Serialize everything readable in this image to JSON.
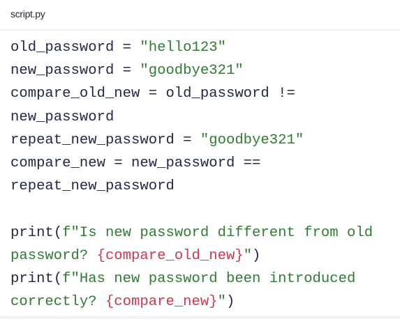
{
  "header": {
    "filename": "script.py"
  },
  "code": {
    "language": "python",
    "colors": {
      "plain": "#232848",
      "string": "#2e7d32",
      "interpolation": "#d1384f"
    },
    "lines": [
      [
        {
          "t": "plain",
          "v": "old_password = "
        },
        {
          "t": "string",
          "v": "\"hello123\""
        }
      ],
      [
        {
          "t": "plain",
          "v": "new_password = "
        },
        {
          "t": "string",
          "v": "\"goodbye321\""
        }
      ],
      [
        {
          "t": "plain",
          "v": "compare_old_new = old_password !="
        }
      ],
      [
        {
          "t": "plain",
          "v": "new_password"
        }
      ],
      [
        {
          "t": "plain",
          "v": "repeat_new_password = "
        },
        {
          "t": "string",
          "v": "\"goodbye321\""
        }
      ],
      [
        {
          "t": "plain",
          "v": "compare_new = new_password =="
        }
      ],
      [
        {
          "t": "plain",
          "v": "repeat_new_password"
        }
      ],
      [],
      [
        {
          "t": "plain",
          "v": "print("
        },
        {
          "t": "string",
          "v": "f\"Is new password different from old"
        }
      ],
      [
        {
          "t": "string",
          "v": "password? "
        },
        {
          "t": "interp",
          "v": "{compare_old_new}"
        },
        {
          "t": "string",
          "v": "\""
        },
        {
          "t": "plain",
          "v": ")"
        }
      ],
      [
        {
          "t": "plain",
          "v": "print("
        },
        {
          "t": "string",
          "v": "f\"Has new password been introduced"
        }
      ],
      [
        {
          "t": "string",
          "v": "correctly? "
        },
        {
          "t": "interp",
          "v": "{compare_new}"
        },
        {
          "t": "string",
          "v": "\""
        },
        {
          "t": "plain",
          "v": ")"
        }
      ]
    ]
  }
}
